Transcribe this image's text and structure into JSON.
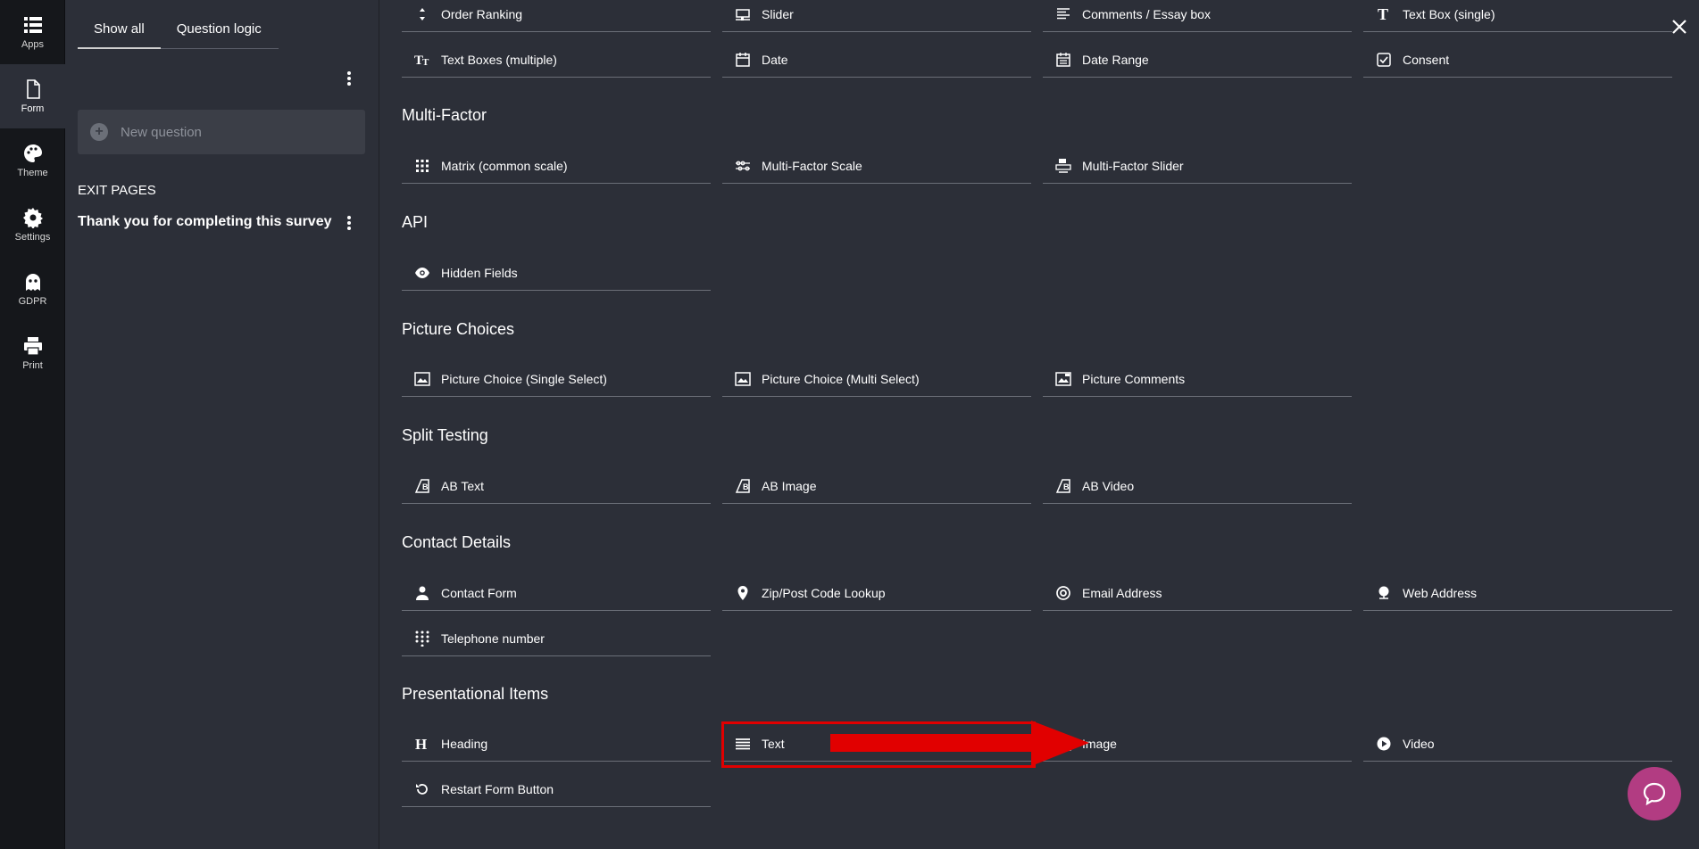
{
  "rail": [
    {
      "label": "Apps",
      "icon": "apps-icon"
    },
    {
      "label": "Form",
      "icon": "form-icon",
      "active": true
    },
    {
      "label": "Theme",
      "icon": "palette-icon"
    },
    {
      "label": "Settings",
      "icon": "gear-icon"
    },
    {
      "label": "GDPR",
      "icon": "ghost-icon"
    },
    {
      "label": "Print",
      "icon": "printer-icon"
    }
  ],
  "panel": {
    "tabs": [
      "Show all",
      "Question logic"
    ],
    "new_question": "New question",
    "exit_pages_title": "EXIT PAGES",
    "exit_page": "Thank you for completing this survey"
  },
  "sections": {
    "multifactor": "Multi-Factor",
    "api": "API",
    "picture": "Picture Choices",
    "split": "Split Testing",
    "contact": "Contact Details",
    "presentational": "Presentational Items"
  },
  "items": {
    "order_ranking": "Order Ranking",
    "slider": "Slider",
    "comments": "Comments / Essay box",
    "text_box_single": "Text Box (single)",
    "text_boxes_multi": "Text Boxes (multiple)",
    "date": "Date",
    "date_range": "Date Range",
    "consent": "Consent",
    "matrix": "Matrix (common scale)",
    "mf_scale": "Multi-Factor Scale",
    "mf_slider": "Multi-Factor Slider",
    "hidden_fields": "Hidden Fields",
    "pic_single": "Picture Choice (Single Select)",
    "pic_multi": "Picture Choice (Multi Select)",
    "pic_comments": "Picture Comments",
    "ab_text": "AB Text",
    "ab_image": "AB Image",
    "ab_video": "AB Video",
    "contact_form": "Contact Form",
    "zip_lookup": "Zip/Post Code Lookup",
    "email": "Email Address",
    "web": "Web Address",
    "phone": "Telephone number",
    "heading": "Heading",
    "text": "Text",
    "image": "Image",
    "video": "Video",
    "restart": "Restart Form Button"
  },
  "colors": {
    "highlight": "#e10000",
    "chat": "#b23c82"
  }
}
